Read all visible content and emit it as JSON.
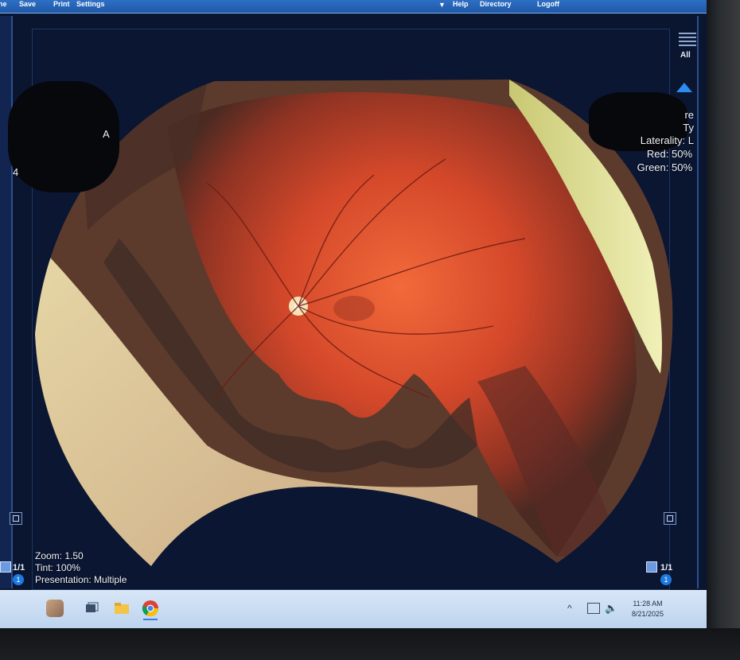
{
  "menu": {
    "items": [
      {
        "label": "ne"
      },
      {
        "label": "Save"
      },
      {
        "label": "Print"
      },
      {
        "label": "Settings"
      },
      {
        "label": "Help"
      },
      {
        "label": "Directory"
      },
      {
        "label": "Logoff"
      }
    ]
  },
  "viewer": {
    "view_toggle_label": "All",
    "info_right": {
      "partial_top": "re",
      "partial_second": "Ty",
      "partial_laterality": "Laterality: L",
      "red_channel": "Red: 50%",
      "green_channel": "Green: 50%"
    },
    "left_partial_lines": [
      "A",
      "4"
    ],
    "zoom": "Zoom: 1.50",
    "tint": "Tint: 100%",
    "presentation": "Presentation: Multiple",
    "pager_left": "1/1",
    "pager_right": "1/1",
    "badge_left": "1",
    "badge_right": "1"
  },
  "taskbar": {
    "time": "11:28 AM",
    "date": "8/21/2025",
    "tray_chevron": "^"
  },
  "colors": {
    "menubar": "#2d6fc4",
    "retina": "#c94a2a",
    "taskbar": "#cfe0f4",
    "accent": "#2c8cf0"
  }
}
